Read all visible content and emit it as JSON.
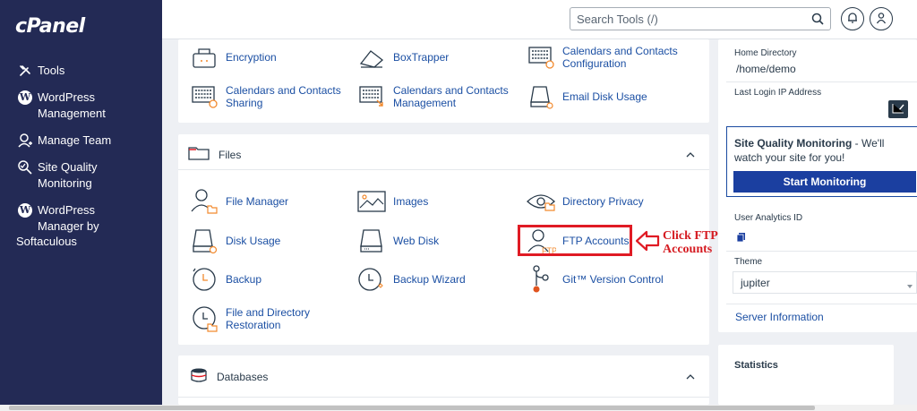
{
  "brand": {
    "logo": "cPanel"
  },
  "sidebar": {
    "items": [
      {
        "label": "Tools",
        "icon": "tools-icon"
      },
      {
        "label": "WordPress\nManagement",
        "icon": "wordpress-icon"
      },
      {
        "label": "Manage Team",
        "icon": "manage-team-icon"
      },
      {
        "label": "Site Quality\nMonitoring",
        "icon": "site-quality-icon"
      },
      {
        "label": "WordPress\nManager by",
        "icon": "wordpress-icon"
      }
    ],
    "extra_label": "Softaculous"
  },
  "header": {
    "search_placeholder": "Search Tools (/)"
  },
  "security_tools": [
    {
      "label": "Encryption",
      "icon": "encryption-icon"
    },
    {
      "label": "BoxTrapper",
      "icon": "boxtrapper-icon"
    },
    {
      "label": "Calendars and Contacts\nConfiguration",
      "icon": "calendar-config-icon"
    },
    {
      "label": "Calendars and Contacts\nSharing",
      "icon": "calendar-sharing-icon"
    },
    {
      "label": "Calendars and Contacts\nManagement",
      "icon": "calendar-management-icon"
    },
    {
      "label": "Email Disk Usage",
      "icon": "email-disk-usage-icon"
    }
  ],
  "files": {
    "title": "Files",
    "tools": [
      {
        "label": "File Manager",
        "icon": "file-manager-icon"
      },
      {
        "label": "Images",
        "icon": "images-icon"
      },
      {
        "label": "Directory Privacy",
        "icon": "directory-privacy-icon"
      },
      {
        "label": "Disk Usage",
        "icon": "disk-usage-icon"
      },
      {
        "label": "Web Disk",
        "icon": "web-disk-icon"
      },
      {
        "label": "FTP Accounts",
        "icon": "ftp-accounts-icon"
      },
      {
        "label": "Backup",
        "icon": "backup-icon"
      },
      {
        "label": "Backup Wizard",
        "icon": "backup-wizard-icon"
      },
      {
        "label": "Git™ Version Control",
        "icon": "git-icon"
      },
      {
        "label": "File and Directory\nRestoration",
        "icon": "file-restoration-icon"
      }
    ]
  },
  "databases": {
    "title": "Databases"
  },
  "annotation": {
    "text": "Click FTP\nAccounts",
    "color": "#d51c22"
  },
  "info": {
    "home_directory_label": "Home Directory",
    "home_directory_value": "/home/demo",
    "last_login_label": "Last Login IP Address",
    "user_analytics_label": "User Analytics ID",
    "theme_label": "Theme",
    "theme_value": "jupiter",
    "server_info_link": "Server Information"
  },
  "sqm": {
    "title": "Site Quality Monitoring",
    "text": " - We'll watch your site for you!",
    "button": "Start Monitoring"
  },
  "statistics": {
    "title": "Statistics"
  },
  "colors": {
    "sidebar": "#232a55",
    "link": "#1b4fa3",
    "primary_button": "#1b3fa0",
    "highlight": "#e01b24"
  }
}
